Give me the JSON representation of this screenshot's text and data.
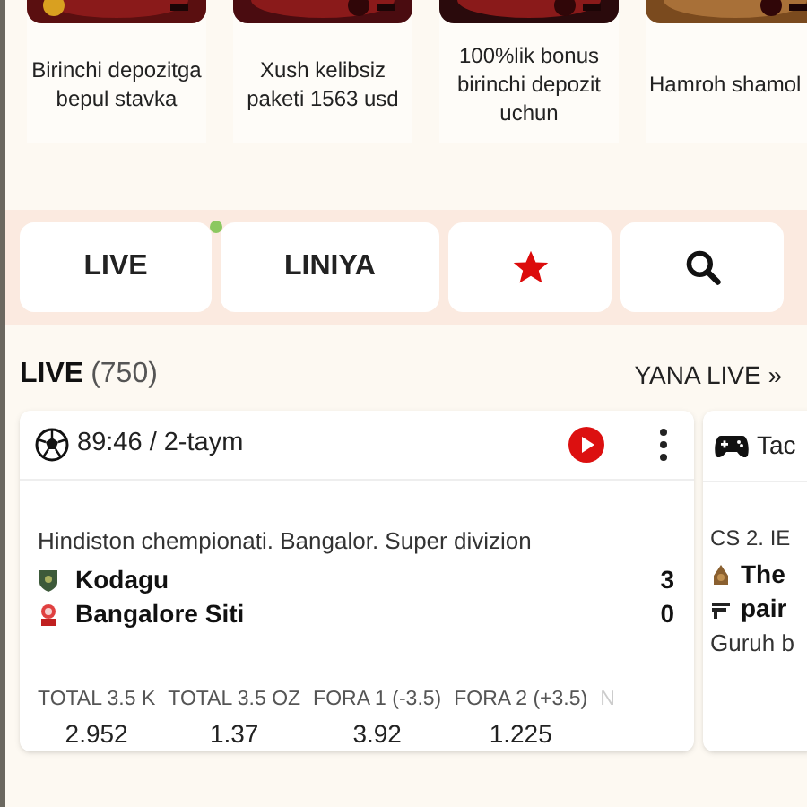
{
  "promos": [
    {
      "label": "Birinchi depozitga bepul stavka",
      "kind": "picture"
    },
    {
      "label": "Xush kelibsiz paketi 1563 usd",
      "kind": "picture"
    },
    {
      "label": "100%lik bonus birinchi depozit uchun",
      "kind": "picture"
    },
    {
      "label": "Hamroh shamol",
      "kind": "picture"
    }
  ],
  "nav": [
    {
      "kind": "text",
      "label": "LIVE",
      "live_dot": true
    },
    {
      "kind": "text",
      "label": "LINIYA",
      "live_dot": false
    },
    {
      "kind": "star"
    },
    {
      "kind": "search"
    }
  ],
  "live": {
    "title": "LIVE",
    "count": "(750)",
    "more": "YANA LIVE",
    "more_icon": "»"
  },
  "matches": [
    {
      "kind": "football",
      "time": "89:46 / 2-taym",
      "stream": true,
      "league": "Hindiston chempionati. Bangalor. Super divizion",
      "teams": [
        {
          "name": "Kodagu",
          "score": "3"
        },
        {
          "name": "Bangalore Siti",
          "score": "0"
        }
      ],
      "odds": [
        {
          "label": "TOTAL 3.5 K",
          "value": "2.952"
        },
        {
          "label": "TOTAL 3.5 OZ",
          "value": "1.37"
        },
        {
          "label": "FORA 1 (-3.5)",
          "value": "3.92"
        },
        {
          "label": "FORA 2 (+3.5)",
          "value": "1.225"
        },
        {
          "label": "N"
        }
      ]
    },
    {
      "kind": "esports",
      "time": "Tac",
      "league": "CS 2. IE",
      "teams": [
        {
          "name": "The"
        },
        {
          "name": "pair"
        }
      ],
      "note": "Guruh b"
    }
  ]
}
